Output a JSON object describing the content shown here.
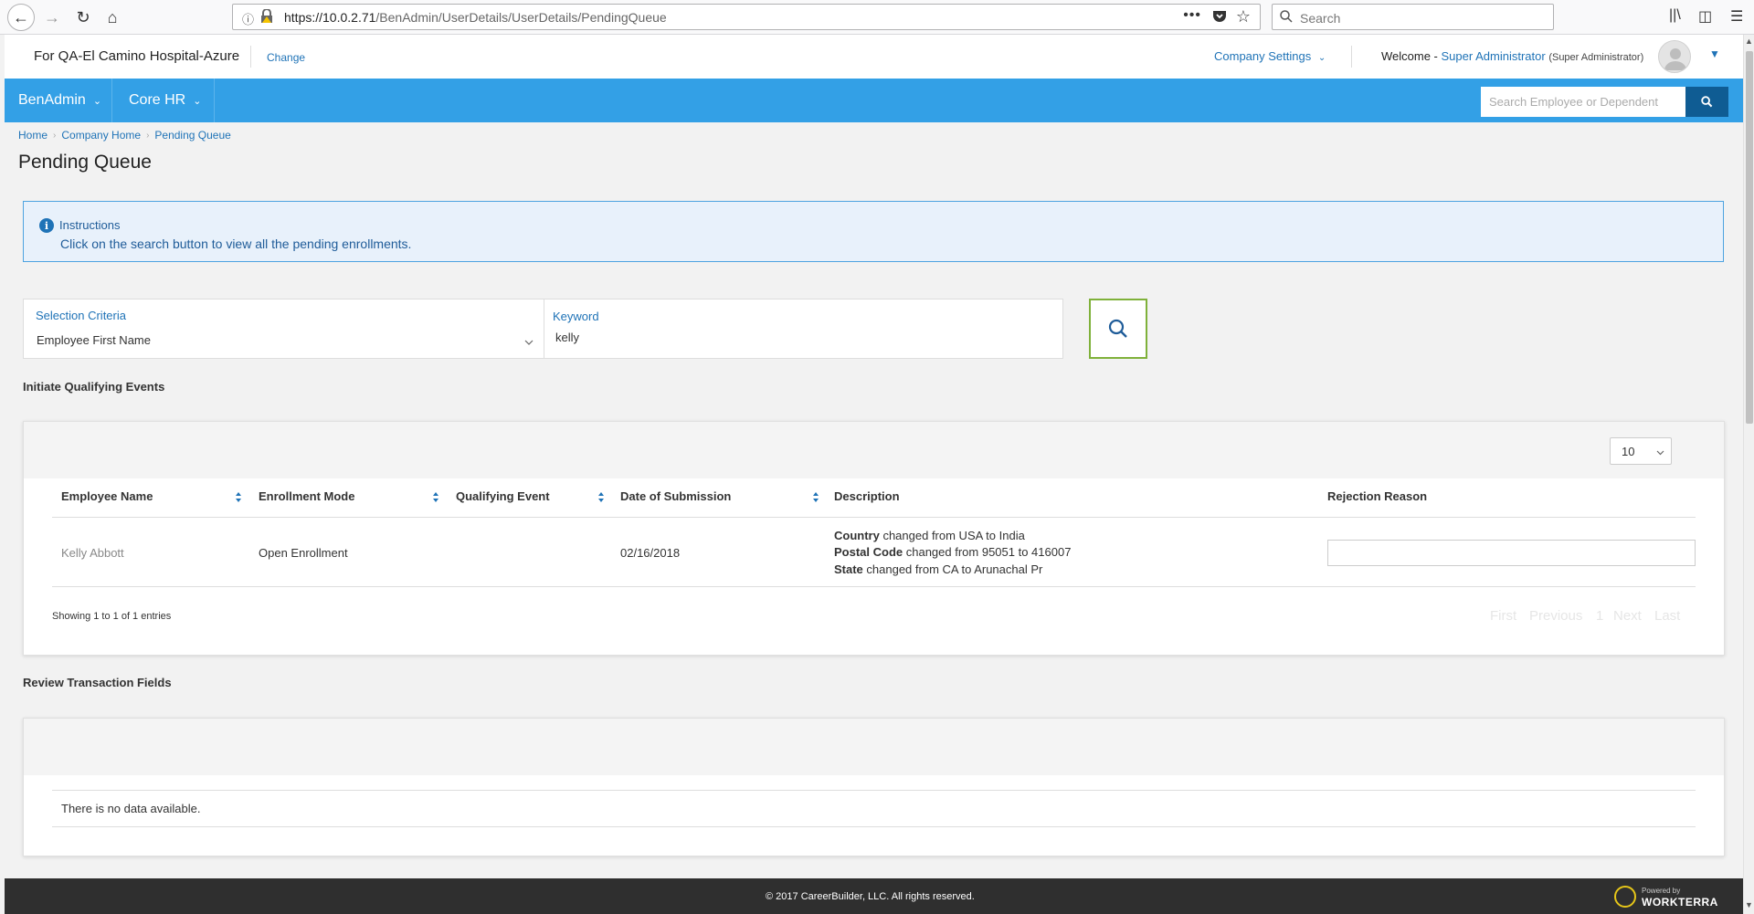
{
  "browser": {
    "url_host": "https://10.0.2.71",
    "url_path": "/BenAdmin/UserDetails/UserDetails/PendingQueue",
    "search_placeholder": "Search"
  },
  "header": {
    "company": "For QA-El Camino Hospital-Azure",
    "change_label": "Change",
    "company_settings_label": "Company Settings",
    "welcome_prefix": "Welcome -",
    "user_name": "Super Administrator",
    "user_role": "(Super Administrator)"
  },
  "nav": {
    "menus": [
      {
        "label": "BenAdmin"
      },
      {
        "label": "Core HR"
      }
    ],
    "search_placeholder": "Search Employee or Dependent"
  },
  "breadcrumb": [
    "Home",
    "Company Home",
    "Pending Queue"
  ],
  "page_title": "Pending Queue",
  "instructions": {
    "title": "Instructions",
    "text": "Click on the search button to view all the pending enrollments."
  },
  "criteria": {
    "selection_label": "Selection Criteria",
    "selection_value": "Employee First Name",
    "keyword_label": "Keyword",
    "keyword_value": "kelly"
  },
  "qualifying": {
    "section_title": "Initiate Qualifying Events",
    "page_size": "10",
    "columns": [
      "Employee Name",
      "Enrollment Mode",
      "Qualifying Event",
      "Date of Submission",
      "Description",
      "Rejection Reason"
    ],
    "rows": [
      {
        "employee_name": "Kelly Abbott",
        "enrollment_mode": "Open Enrollment",
        "qualifying_event": "",
        "date_of_submission": "02/16/2018",
        "description": [
          {
            "field": "Country",
            "text": " changed from USA to India"
          },
          {
            "field": "Postal Code",
            "text": " changed from 95051 to 416007"
          },
          {
            "field": "State",
            "text": " changed from CA to Arunachal Pr"
          }
        ],
        "rejection_reason": ""
      }
    ],
    "showing": "Showing 1 to 1 of 1 entries",
    "pager": [
      "First",
      "Previous",
      "1",
      "Next",
      "Last"
    ]
  },
  "review": {
    "section_title": "Review Transaction Fields",
    "empty_text": "There is no data available."
  },
  "footer": {
    "copyright": "© 2017 CareerBuilder, LLC. All rights reserved.",
    "powered_by": "Powered by",
    "brand": "WORKTERRA"
  },
  "colors": {
    "nav_blue": "#33a0e6",
    "link_blue": "#1f73b7",
    "search_btn": "#0f5c93",
    "go_border": "#7fb13a",
    "footer": "#2f2f2f"
  }
}
